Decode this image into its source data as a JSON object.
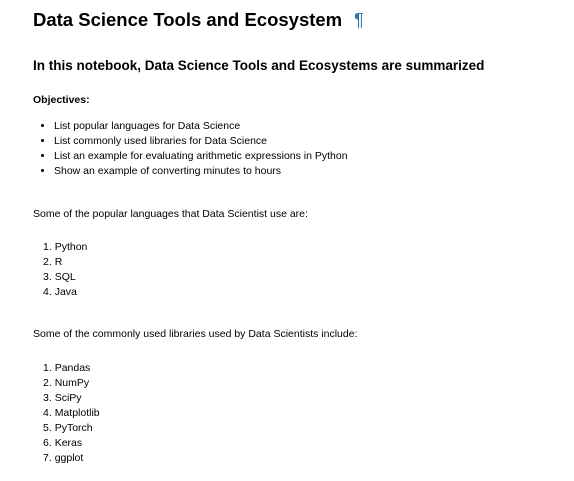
{
  "heading": {
    "title": "Data Science Tools and Ecosystem",
    "anchor": "¶"
  },
  "subheading": "In this notebook, Data Science Tools and Ecosystems are summarized",
  "objectives": {
    "title": "Objectives:",
    "items": [
      "List popular languages for Data Science",
      "List commonly used libraries for Data Science",
      "List an example for evaluating arithmetic expressions in Python",
      "Show an example of converting minutes to hours"
    ]
  },
  "languages": {
    "intro": "Some of the popular languages that Data Scientist use are:",
    "items": [
      {
        "num": "1.",
        "label": "Python"
      },
      {
        "num": "2.",
        "label": "R"
      },
      {
        "num": "3.",
        "label": "SQL"
      },
      {
        "num": "4.",
        "label": "Java"
      }
    ]
  },
  "libraries": {
    "intro": "Some of the commonly used libraries used by Data Scientists include:",
    "items": [
      {
        "num": "1.",
        "label": "Pandas"
      },
      {
        "num": "2.",
        "label": "NumPy"
      },
      {
        "num": "3.",
        "label": "SciPy"
      },
      {
        "num": "4.",
        "label": "Matplotlib"
      },
      {
        "num": "5.",
        "label": "PyTorch"
      },
      {
        "num": "6.",
        "label": "Keras"
      },
      {
        "num": "7.",
        "label": "ggplot"
      }
    ]
  }
}
